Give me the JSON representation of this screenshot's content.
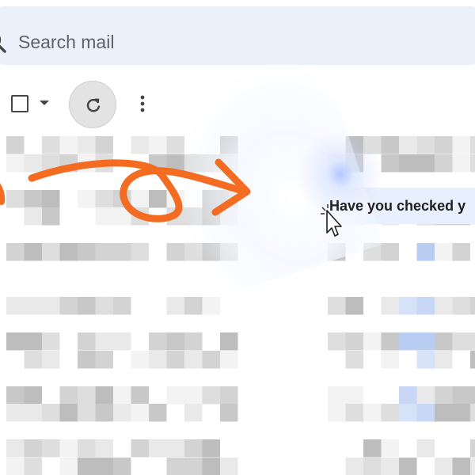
{
  "search": {
    "placeholder": "Search mail"
  },
  "toolbar": {
    "icons": [
      "checkbox-icon",
      "chevron-down-icon",
      "refresh-icon",
      "more-vert-icon"
    ]
  },
  "highlighted_email": {
    "subject": "Have you checked y"
  },
  "annotation": {
    "arrow_color": "#f36c21"
  },
  "colors": {
    "search_bg": "#eaf1fb",
    "row_hover_bg": "#e8f0fe",
    "refresh_bg": "#e3e3e3"
  }
}
